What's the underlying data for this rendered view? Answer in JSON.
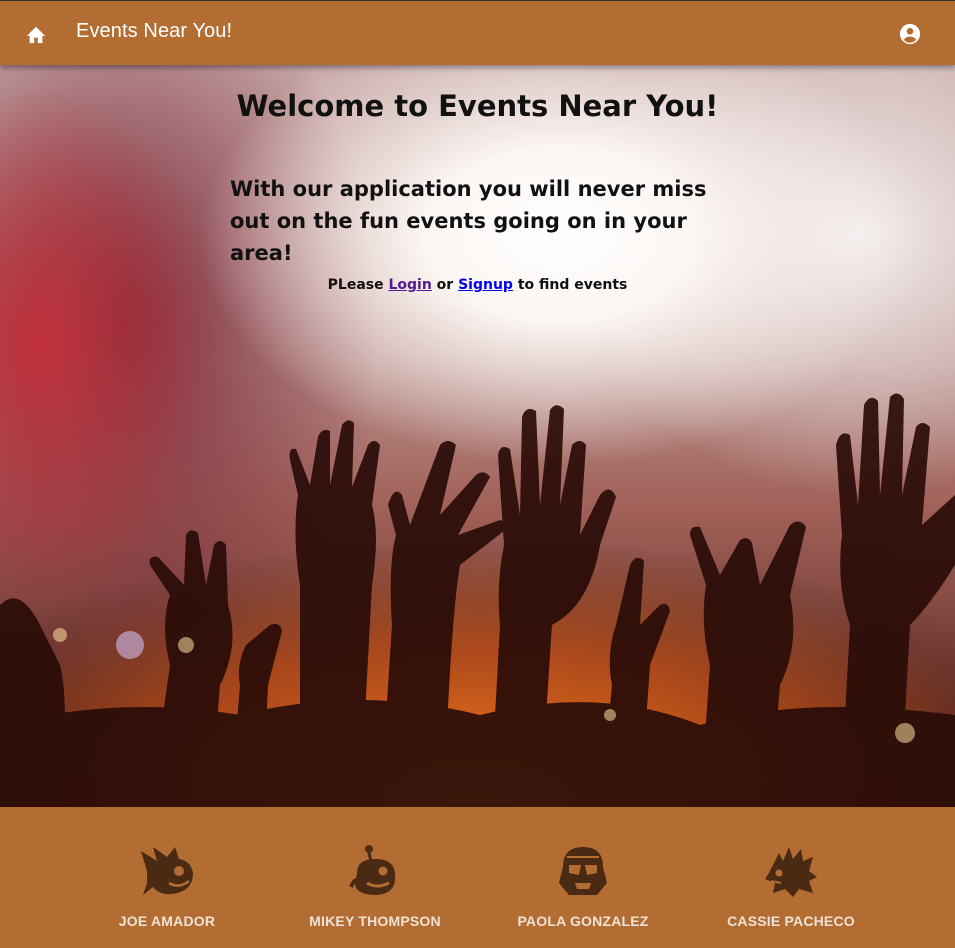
{
  "appbar": {
    "title": "Events Near You!",
    "home_icon": "home-icon",
    "account_icon": "account-circle-icon",
    "background": "#b36d33"
  },
  "hero": {
    "title": "Welcome to Events Near You!",
    "subtitle": "With our application you will never miss out on the fun events going on in your area!",
    "cta_prefix": "PLease",
    "login_label": "Login",
    "cta_or": "or",
    "signup_label": "Signup",
    "cta_suffix": "to find events",
    "background_image": "concert crowd with raised hands"
  },
  "footer": {
    "background": "#b36d33",
    "members": [
      {
        "name": "JOE AMADOR",
        "icon": "hedgehog-icon"
      },
      {
        "name": "MIKEY THOMPSON",
        "icon": "creature-icon"
      },
      {
        "name": "PAOLA GONZALEZ",
        "icon": "stormtrooper-helmet-icon"
      },
      {
        "name": "CASSIE PACHECO",
        "icon": "dragon-icon"
      }
    ]
  }
}
